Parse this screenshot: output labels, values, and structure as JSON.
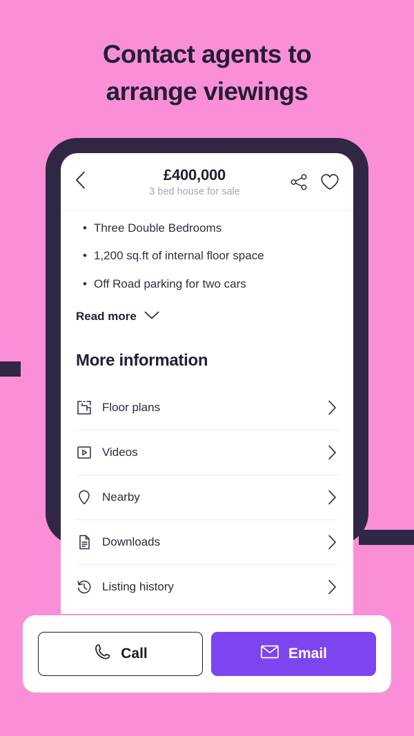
{
  "promo": {
    "headline_line1": "Contact agents to",
    "headline_line2": "arrange viewings",
    "background_color": "#fa8fd8",
    "frame_color": "#302744",
    "heading_color": "#241e35"
  },
  "app": {
    "header": {
      "back_icon": "chevron-left-icon",
      "price": "£400,000",
      "subtitle": "3 bed house for sale",
      "share_icon": "share-icon",
      "favourite_icon": "heart-icon"
    },
    "features": [
      {
        "bullet": "•",
        "text": "Three Double Bedrooms"
      },
      {
        "bullet": "•",
        "text": "1,200 sq.ft of internal floor space"
      },
      {
        "bullet": "•",
        "text": "Off Road parking for two cars"
      }
    ],
    "read_more": {
      "label": "Read more",
      "icon": "chevron-down-icon"
    },
    "more_information": {
      "title": "More information",
      "rows": [
        {
          "label": "Floor plans",
          "icon": "floorplan-icon",
          "chevron": "chevron-right-icon"
        },
        {
          "label": "Videos",
          "icon": "video-play-icon",
          "chevron": "chevron-right-icon"
        },
        {
          "label": "Nearby",
          "icon": "map-pin-icon",
          "chevron": "chevron-right-icon"
        },
        {
          "label": "Downloads",
          "icon": "document-icon",
          "chevron": "chevron-right-icon"
        },
        {
          "label": "Listing history",
          "icon": "clock-history-icon",
          "chevron": "chevron-right-icon"
        }
      ]
    },
    "actions": {
      "call": {
        "label": "Call",
        "icon": "phone-icon",
        "style": "outline"
      },
      "email": {
        "label": "Email",
        "icon": "envelope-icon",
        "style": "filled",
        "color": "#7c45f0"
      }
    }
  }
}
